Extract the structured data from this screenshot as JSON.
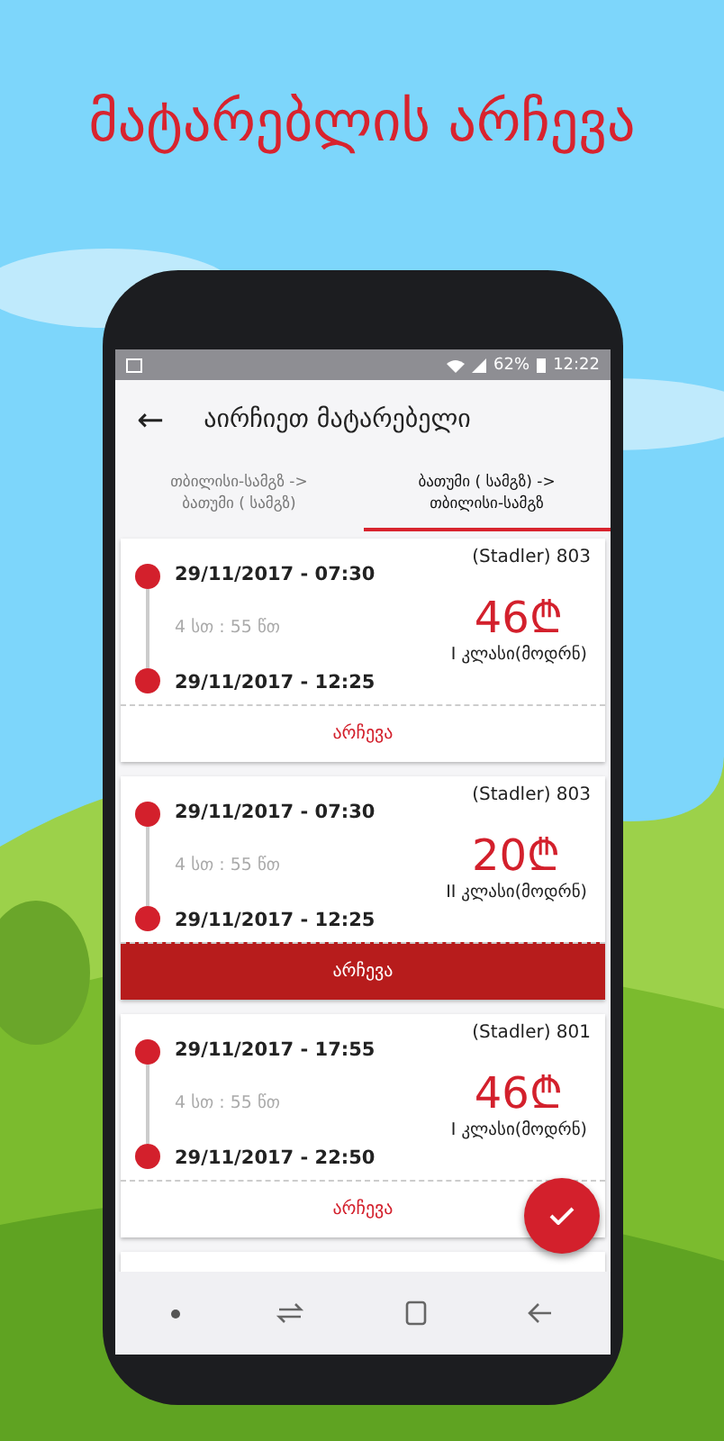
{
  "title": "მატარებლის არჩევა",
  "status_bar": {
    "battery": "62%",
    "time": "12:22"
  },
  "header": {
    "back": "←",
    "title": "აირჩიეთ მატარებელი"
  },
  "tabs": [
    {
      "label": "თბილისი-სამგზ -> ბათუმი ( სამგზ)",
      "selected": false
    },
    {
      "label": "ბათუმი ( სამგზ) -> თბილისი-სამგზ",
      "selected": true
    }
  ],
  "trains": [
    {
      "train": "(Stadler) 803",
      "depart": "29/11/2017 - 07:30",
      "duration": "4 სთ : 55 წთ",
      "arrive": "29/11/2017 - 12:25",
      "price": "46₾",
      "class": "I კლასი(მოდრნ)",
      "button": "არჩევა",
      "selected": false
    },
    {
      "train": "(Stadler) 803",
      "depart": "29/11/2017 - 07:30",
      "duration": "4 სთ : 55 წთ",
      "arrive": "29/11/2017 - 12:25",
      "price": "20₾",
      "class": "II კლასი(მოდრნ)",
      "button": "არჩევა",
      "selected": true
    },
    {
      "train": "(Stadler) 801",
      "depart": "29/11/2017 - 17:55",
      "duration": "4 სთ : 55 წთ",
      "arrive": "29/11/2017 - 22:50",
      "price": "46₾",
      "class": "I კლასი(მოდრნ)",
      "button": "არჩევა",
      "selected": false
    }
  ]
}
